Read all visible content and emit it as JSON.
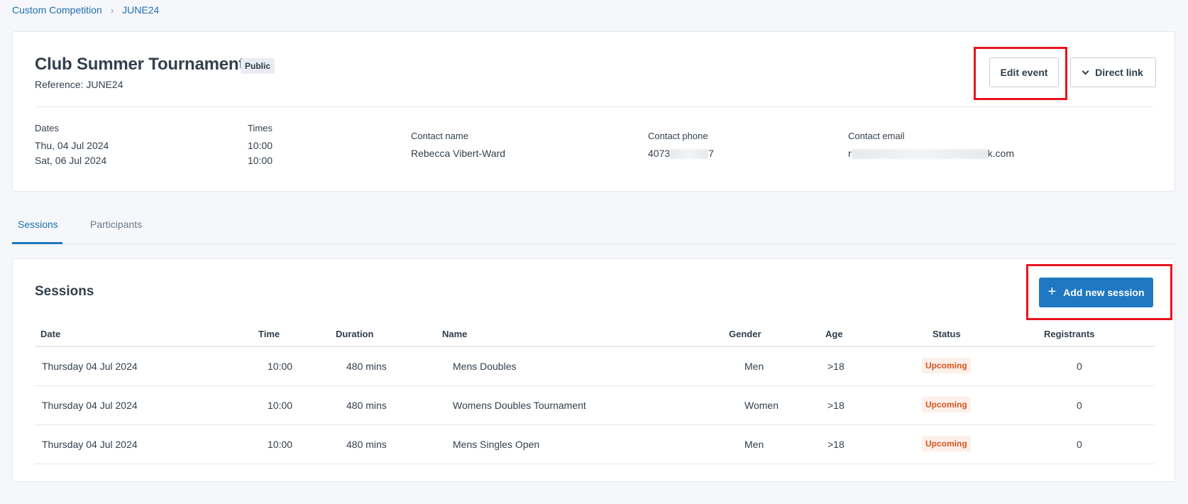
{
  "breadcrumb": {
    "parent": "Custom Competition",
    "separator": "›",
    "current": "JUNE24"
  },
  "event": {
    "title": "Club Summer Tournament",
    "visibility_badge": "Public",
    "reference": "Reference: JUNE24",
    "edit_label": "Edit event",
    "direct_link_label": "Direct link",
    "dates_label": "Dates",
    "dates": [
      "Thu, 04 Jul 2024",
      "Sat, 06 Jul 2024"
    ],
    "times_label": "Times",
    "times": [
      "10:00",
      "10:00"
    ],
    "contact_name_label": "Contact name",
    "contact_name": "Rebecca Vibert-Ward",
    "contact_phone_label": "Contact phone",
    "contact_phone_start": "4073",
    "contact_phone_end": "7",
    "contact_email_label": "Contact email",
    "contact_email_start": "r",
    "contact_email_end": "k.com"
  },
  "tabs": [
    {
      "label": "Sessions",
      "active": true
    },
    {
      "label": "Participants",
      "active": false
    }
  ],
  "sessions": {
    "title": "Sessions",
    "add_label": "Add new session",
    "columns": [
      "Date",
      "Time",
      "Duration",
      "Name",
      "Gender",
      "Age",
      "Status",
      "Registrants"
    ],
    "rows": [
      {
        "date": "Thursday 04 Jul 2024",
        "time": "10:00",
        "duration": "480 mins",
        "name": "Mens Doubles",
        "gender": "Men",
        "age": ">18",
        "status": "Upcoming",
        "registrants": "0"
      },
      {
        "date": "Thursday 04 Jul 2024",
        "time": "10:00",
        "duration": "480 mins",
        "name": "Womens Doubles Tournament",
        "gender": "Women",
        "age": ">18",
        "status": "Upcoming",
        "registrants": "0"
      },
      {
        "date": "Thursday 04 Jul 2024",
        "time": "10:00",
        "duration": "480 mins",
        "name": "Mens Singles Open",
        "gender": "Men",
        "age": ">18",
        "status": "Upcoming",
        "registrants": "0"
      }
    ]
  },
  "colors": {
    "accent": "#1f78c1",
    "highlight": "#e8141c",
    "status_upcoming": "#d9541e"
  }
}
